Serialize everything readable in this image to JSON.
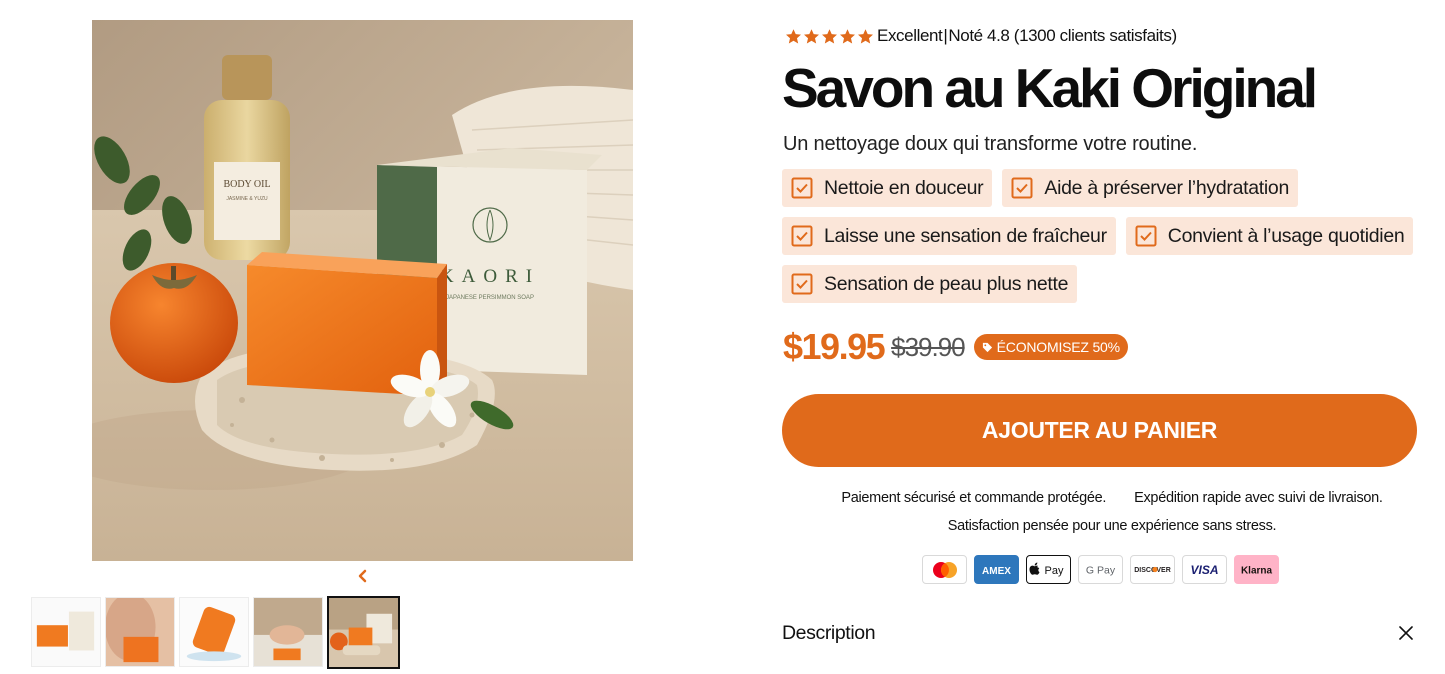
{
  "rating": {
    "stars": 5,
    "label": "Excellent",
    "separator": "|",
    "detail": "Noté 4.8 (1300 clients satisfaits)",
    "star_color": "#e06a1b"
  },
  "product": {
    "title": "Savon au Kaki Original",
    "subtitle": "Un nettoyage doux qui transforme votre routine.",
    "packaging_text": {
      "bottle_label": "BODY OIL",
      "bottle_sub": "JASMINE & YUZU",
      "box_brand": "KAORI",
      "box_sub": "JAPANESE PERSIMMON SOAP"
    }
  },
  "benefits": [
    {
      "label": "Nettoie en douceur"
    },
    {
      "label": "Aide à préserver l’hydratation"
    },
    {
      "label": "Laisse une sensation de fraîcheur"
    },
    {
      "label": "Convient à l’usage quotidien"
    },
    {
      "label": "Sensation de peau plus nette"
    }
  ],
  "pricing": {
    "price": "$19.95",
    "compare_price": "$39.90",
    "badge": "ÉCONOMISEZ 50%"
  },
  "cart": {
    "label": "AJOUTER AU PANIER"
  },
  "trust": {
    "line1a": "Paiement sécurisé et commande protégée.",
    "line1b": "Expédition rapide avec suivi de livraison.",
    "line2": "Satisfaction pensée pour une expérience sans stress."
  },
  "payments": [
    {
      "name": "mastercard-icon"
    },
    {
      "name": "amex-icon",
      "text": "AMEX"
    },
    {
      "name": "apple-pay-icon",
      "text": "Pay"
    },
    {
      "name": "google-pay-icon",
      "text": "G Pay"
    },
    {
      "name": "discover-icon",
      "text": "DISCOVER"
    },
    {
      "name": "visa-icon",
      "text": "VISA"
    },
    {
      "name": "klarna-icon",
      "text": "Klarna"
    }
  ],
  "description": {
    "label": "Description"
  },
  "gallery": {
    "thumb_count": 5,
    "active_index": 4
  },
  "colors": {
    "accent": "#e06a1b",
    "chip_bg": "#fbe6d9",
    "klarna_pink": "#ffb3c7",
    "amex_blue": "#2e77bc",
    "visa_blue": "#1a1f71"
  }
}
